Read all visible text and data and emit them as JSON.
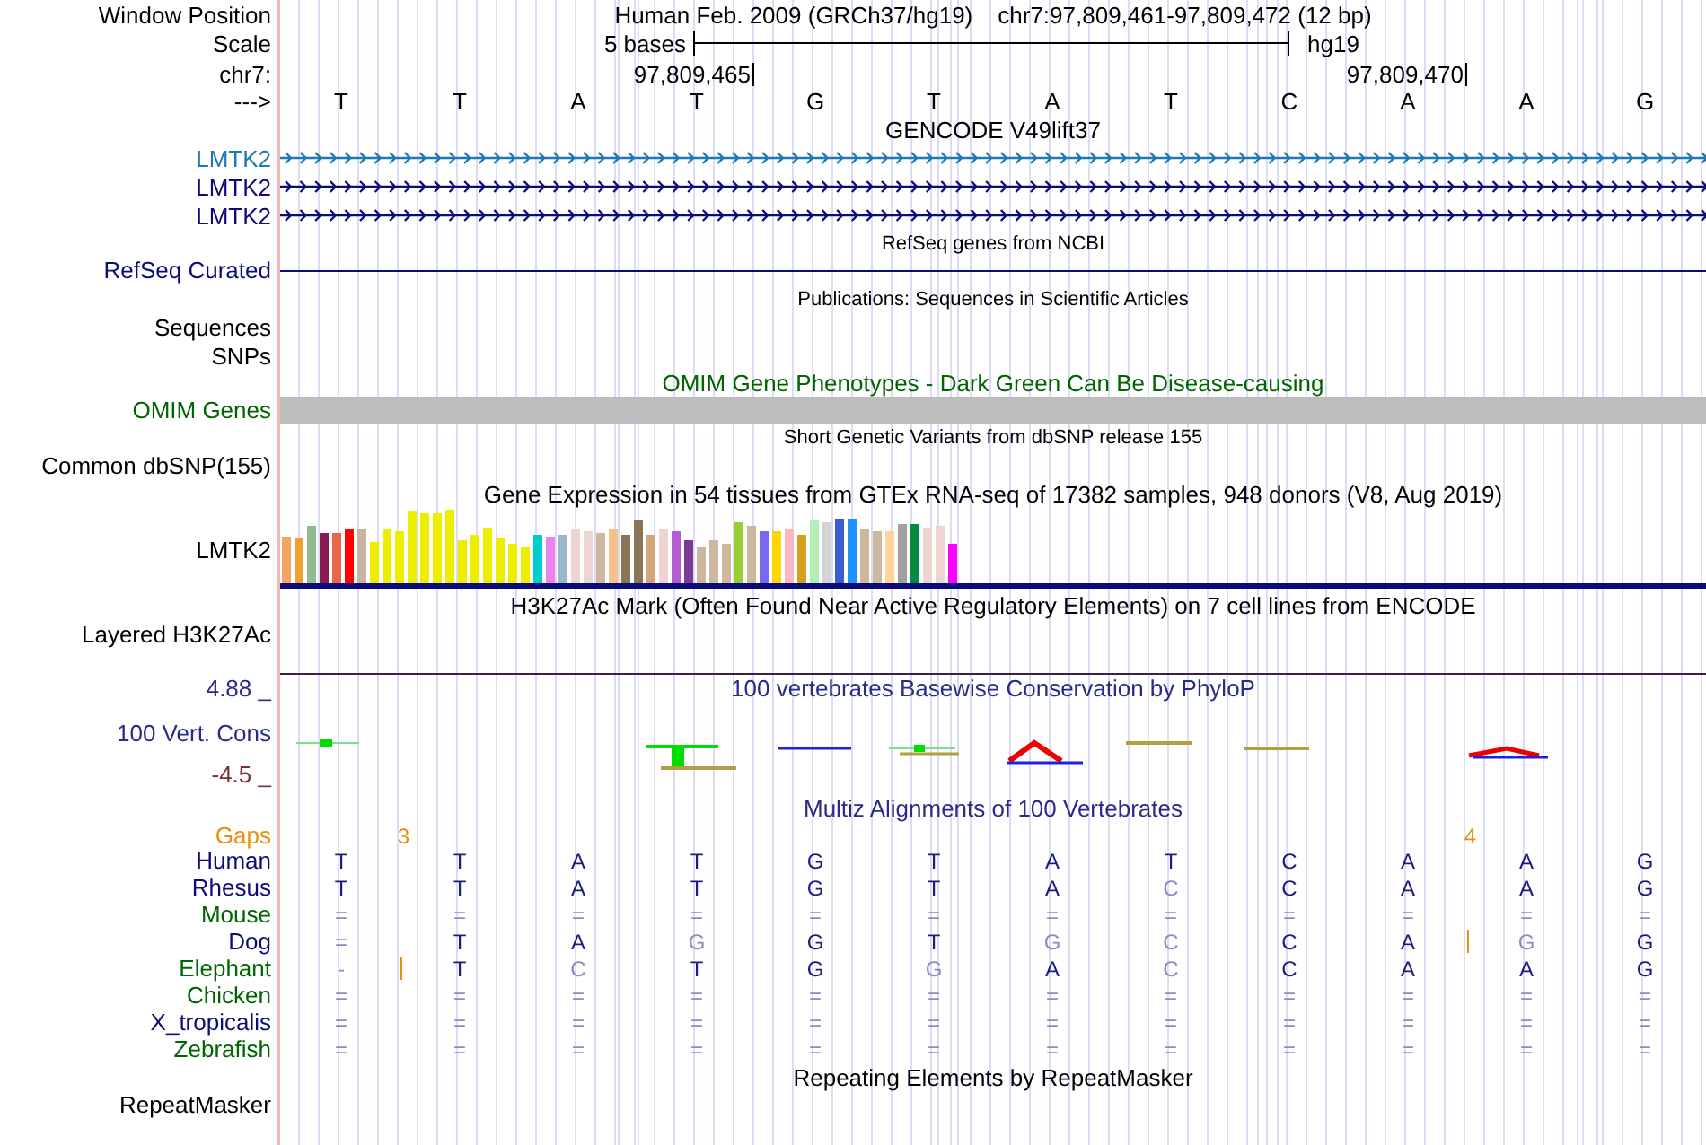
{
  "ruler": {
    "position_label": "Window Position",
    "assembly": "Human Feb. 2009 (GRCh37/hg19)",
    "range": "chr7:97,809,461-97,809,472 (12 bp)",
    "scale_label": "Scale",
    "scale_text": "5 bases",
    "scale_db": "hg19",
    "chrom_label": "chr7:",
    "ticks": [
      "97,809,465",
      "97,809,470"
    ],
    "strand_label": "--->",
    "bases": [
      "T",
      "T",
      "A",
      "T",
      "G",
      "T",
      "A",
      "T",
      "C",
      "A",
      "A",
      "G"
    ]
  },
  "tracks": [
    {
      "kind": "gencode",
      "title": "GENCODE V49lift37",
      "genes": [
        {
          "label": "LMTK2",
          "color": "#1f78b4"
        },
        {
          "label": "LMTK2",
          "color": "#0c0c78"
        },
        {
          "label": "LMTK2",
          "color": "#0c0c78"
        }
      ]
    },
    {
      "kind": "refseq",
      "title": "RefSeq genes from NCBI",
      "label": "RefSeq Curated"
    },
    {
      "kind": "publications",
      "title": "Publications: Sequences in Scientific Articles",
      "labels": [
        "Sequences",
        "SNPs"
      ]
    },
    {
      "kind": "omim",
      "title": "OMIM Gene Phenotypes - Dark Green Can Be Disease-causing",
      "label": "OMIM Genes"
    },
    {
      "kind": "dbsnp",
      "title": "Short Genetic Variants from dbSNP release 155",
      "label": "Common dbSNP(155)"
    },
    {
      "kind": "gtex",
      "title": "Gene Expression in 54 tissues from GTEx RNA-seq of 17382 samples, 948 donors (V8, Aug 2019)",
      "label": "LMTK2"
    },
    {
      "kind": "h3k27ac",
      "title": "H3K27Ac Mark (Often Found Near Active Regulatory Elements) on 7 cell lines from ENCODE",
      "label": "Layered H3K27Ac"
    },
    {
      "kind": "phylop",
      "title": "100 vertebrates Basewise Conservation by PhyloP",
      "label": "100 Vert. Cons",
      "max": "4.88 _",
      "min": "-4.5 _"
    },
    {
      "kind": "multiz",
      "title": "Multiz Alignments of 100 Vertebrates",
      "gaps_label": "Gaps",
      "gaps": [
        "3",
        "4"
      ],
      "species": [
        {
          "name": "Human",
          "color": "#0c0c78",
          "cells": [
            {
              "text": "T",
              "dim": false,
              "insertion": false
            },
            {
              "text": "T",
              "dim": false,
              "insertion": false
            },
            {
              "text": "A",
              "dim": false,
              "insertion": false
            },
            {
              "text": "T",
              "dim": false,
              "insertion": false
            },
            {
              "text": "G",
              "dim": false,
              "insertion": false
            },
            {
              "text": "T",
              "dim": false,
              "insertion": false
            },
            {
              "text": "A",
              "dim": false,
              "insertion": false
            },
            {
              "text": "T",
              "dim": false,
              "insertion": false
            },
            {
              "text": "C",
              "dim": false,
              "insertion": false
            },
            {
              "text": "A",
              "dim": false,
              "insertion": false
            },
            {
              "text": "A",
              "dim": false,
              "insertion": false
            },
            {
              "text": "G",
              "dim": false,
              "insertion": false
            }
          ]
        },
        {
          "name": "Rhesus",
          "color": "#0c0c78",
          "cells": [
            {
              "text": "T",
              "dim": false,
              "insertion": false
            },
            {
              "text": "T",
              "dim": false,
              "insertion": false
            },
            {
              "text": "A",
              "dim": false,
              "insertion": false
            },
            {
              "text": "T",
              "dim": false,
              "insertion": false
            },
            {
              "text": "G",
              "dim": false,
              "insertion": false
            },
            {
              "text": "T",
              "dim": false,
              "insertion": false
            },
            {
              "text": "A",
              "dim": false,
              "insertion": false
            },
            {
              "text": "C",
              "dim": true,
              "insertion": false
            },
            {
              "text": "C",
              "dim": false,
              "insertion": false
            },
            {
              "text": "A",
              "dim": false,
              "insertion": false
            },
            {
              "text": "A",
              "dim": false,
              "insertion": false
            },
            {
              "text": "G",
              "dim": false,
              "insertion": false
            }
          ]
        },
        {
          "name": "Mouse",
          "color": "#006400",
          "cells": [
            {
              "text": "=",
              "dim": true,
              "insertion": false
            },
            {
              "text": "=",
              "dim": true,
              "insertion": false
            },
            {
              "text": "=",
              "dim": true,
              "insertion": false
            },
            {
              "text": "=",
              "dim": true,
              "insertion": false
            },
            {
              "text": "=",
              "dim": true,
              "insertion": false
            },
            {
              "text": "=",
              "dim": true,
              "insertion": false
            },
            {
              "text": "=",
              "dim": true,
              "insertion": false
            },
            {
              "text": "=",
              "dim": true,
              "insertion": false
            },
            {
              "text": "=",
              "dim": true,
              "insertion": false
            },
            {
              "text": "=",
              "dim": true,
              "insertion": false
            },
            {
              "text": "=",
              "dim": true,
              "insertion": false
            },
            {
              "text": "=",
              "dim": true,
              "insertion": false
            }
          ]
        },
        {
          "name": "Dog",
          "color": "#0c0c78",
          "cells": [
            {
              "text": "=",
              "dim": true,
              "insertion": false
            },
            {
              "text": "T",
              "dim": false,
              "insertion": false
            },
            {
              "text": "A",
              "dim": false,
              "insertion": false
            },
            {
              "text": "G",
              "dim": true,
              "insertion": false
            },
            {
              "text": "G",
              "dim": false,
              "insertion": false
            },
            {
              "text": "T",
              "dim": false,
              "insertion": false
            },
            {
              "text": "G",
              "dim": true,
              "insertion": false
            },
            {
              "text": "C",
              "dim": true,
              "insertion": false
            },
            {
              "text": "C",
              "dim": false,
              "insertion": false
            },
            {
              "text": "A",
              "dim": false,
              "insertion": true
            },
            {
              "text": "G",
              "dim": true,
              "insertion": false
            },
            {
              "text": "G",
              "dim": false,
              "insertion": false
            }
          ]
        },
        {
          "name": "Elephant",
          "color": "#006400",
          "cells": [
            {
              "text": "-",
              "dim": true,
              "insertion": true
            },
            {
              "text": "T",
              "dim": false,
              "insertion": false
            },
            {
              "text": "C",
              "dim": true,
              "insertion": false
            },
            {
              "text": "T",
              "dim": false,
              "insertion": false
            },
            {
              "text": "G",
              "dim": false,
              "insertion": false
            },
            {
              "text": "G",
              "dim": true,
              "insertion": false
            },
            {
              "text": "A",
              "dim": false,
              "insertion": false
            },
            {
              "text": "C",
              "dim": true,
              "insertion": false
            },
            {
              "text": "C",
              "dim": false,
              "insertion": false
            },
            {
              "text": "A",
              "dim": false,
              "insertion": false
            },
            {
              "text": "A",
              "dim": false,
              "insertion": false
            },
            {
              "text": "G",
              "dim": false,
              "insertion": false
            }
          ]
        },
        {
          "name": "Chicken",
          "color": "#006400",
          "cells": [
            {
              "text": "=",
              "dim": true,
              "insertion": false
            },
            {
              "text": "=",
              "dim": true,
              "insertion": false
            },
            {
              "text": "=",
              "dim": true,
              "insertion": false
            },
            {
              "text": "=",
              "dim": true,
              "insertion": false
            },
            {
              "text": "=",
              "dim": true,
              "insertion": false
            },
            {
              "text": "=",
              "dim": true,
              "insertion": false
            },
            {
              "text": "=",
              "dim": true,
              "insertion": false
            },
            {
              "text": "=",
              "dim": true,
              "insertion": false
            },
            {
              "text": "=",
              "dim": true,
              "insertion": false
            },
            {
              "text": "=",
              "dim": true,
              "insertion": false
            },
            {
              "text": "=",
              "dim": true,
              "insertion": false
            },
            {
              "text": "=",
              "dim": true,
              "insertion": false
            }
          ]
        },
        {
          "name": "X_tropicalis",
          "color": "#0c0c78",
          "cells": [
            {
              "text": "=",
              "dim": true,
              "insertion": false
            },
            {
              "text": "=",
              "dim": true,
              "insertion": false
            },
            {
              "text": "=",
              "dim": true,
              "insertion": false
            },
            {
              "text": "=",
              "dim": true,
              "insertion": false
            },
            {
              "text": "=",
              "dim": true,
              "insertion": false
            },
            {
              "text": "=",
              "dim": true,
              "insertion": false
            },
            {
              "text": "=",
              "dim": true,
              "insertion": false
            },
            {
              "text": "=",
              "dim": true,
              "insertion": false
            },
            {
              "text": "=",
              "dim": true,
              "insertion": false
            },
            {
              "text": "=",
              "dim": true,
              "insertion": false
            },
            {
              "text": "=",
              "dim": true,
              "insertion": false
            },
            {
              "text": "=",
              "dim": true,
              "insertion": false
            }
          ]
        },
        {
          "name": "Zebrafish",
          "color": "#006400",
          "cells": [
            {
              "text": "=",
              "dim": true,
              "insertion": false
            },
            {
              "text": "=",
              "dim": true,
              "insertion": false
            },
            {
              "text": "=",
              "dim": true,
              "insertion": false
            },
            {
              "text": "=",
              "dim": true,
              "insertion": false
            },
            {
              "text": "=",
              "dim": true,
              "insertion": false
            },
            {
              "text": "=",
              "dim": true,
              "insertion": false
            },
            {
              "text": "=",
              "dim": true,
              "insertion": false
            },
            {
              "text": "=",
              "dim": true,
              "insertion": false
            },
            {
              "text": "=",
              "dim": true,
              "insertion": false
            },
            {
              "text": "=",
              "dim": true,
              "insertion": false
            },
            {
              "text": "=",
              "dim": true,
              "insertion": false
            },
            {
              "text": "=",
              "dim": true,
              "insertion": false
            }
          ]
        }
      ]
    },
    {
      "kind": "repeatmasker",
      "title": "Repeating Elements by RepeatMasker",
      "label": "RepeatMasker"
    }
  ]
}
